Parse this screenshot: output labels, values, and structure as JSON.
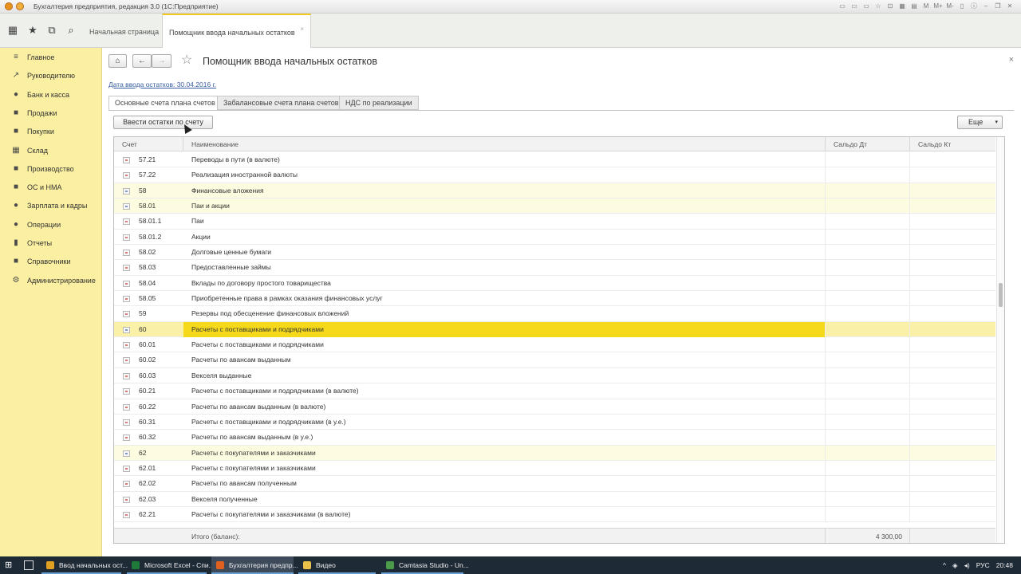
{
  "window": {
    "title": "Бухгалтерия предприятия, редакция 3.0  (1С:Предприятие)",
    "toolbar_icons": [
      "М",
      "М+",
      "М-"
    ]
  },
  "nav": {
    "tabs": [
      "Начальная страница",
      "Помощник ввода начальных остатков"
    ],
    "close": "×"
  },
  "sidebar": {
    "items": [
      {
        "label": "Главное",
        "icon": "menu-icon",
        "glyph": "≡"
      },
      {
        "label": "Руководителю",
        "icon": "chart-line-icon",
        "glyph": "↗"
      },
      {
        "label": "Банк и касса",
        "icon": "bank-icon",
        "glyph": "●"
      },
      {
        "label": "Продажи",
        "icon": "sales-icon",
        "glyph": "■"
      },
      {
        "label": "Покупки",
        "icon": "cart-icon",
        "glyph": "■"
      },
      {
        "label": "Склад",
        "icon": "warehouse-icon",
        "glyph": "▦"
      },
      {
        "label": "Производство",
        "icon": "factory-icon",
        "glyph": "■"
      },
      {
        "label": "ОС и НМА",
        "icon": "assets-icon",
        "glyph": "■"
      },
      {
        "label": "Зарплата и кадры",
        "icon": "person-icon",
        "glyph": "●"
      },
      {
        "label": "Операции",
        "icon": "operations-icon",
        "glyph": "●"
      },
      {
        "label": "Отчеты",
        "icon": "reports-icon",
        "glyph": "▮"
      },
      {
        "label": "Справочники",
        "icon": "books-icon",
        "glyph": "■"
      },
      {
        "label": "Администрирование",
        "icon": "gear-icon",
        "glyph": "⚙"
      }
    ]
  },
  "form": {
    "title": "Помощник ввода начальных остатков",
    "date_link": "Дата ввода остатков: 30.04.2016 г.",
    "tabs": [
      "Основные счета плана счетов",
      "Забалансовые счета плана счетов",
      "НДС по реализации"
    ],
    "enter_button": "Ввести остатки по счету",
    "more_button": "Еще",
    "close": "×"
  },
  "table": {
    "columns": [
      "Счет",
      "Наименование",
      "Сальдо Дт",
      "Сальдо Кт"
    ],
    "rows": [
      {
        "acc": "57.21",
        "name": "Переводы в пути (в валюте)",
        "group": false
      },
      {
        "acc": "57.22",
        "name": "Реализация иностранной валюты",
        "group": false
      },
      {
        "acc": "58",
        "name": "Финансовые вложения",
        "group": true
      },
      {
        "acc": "58.01",
        "name": "Паи и акции",
        "group": true
      },
      {
        "acc": "58.01.1",
        "name": "Паи",
        "group": false
      },
      {
        "acc": "58.01.2",
        "name": "Акции",
        "group": false
      },
      {
        "acc": "58.02",
        "name": "Долговые ценные бумаги",
        "group": false
      },
      {
        "acc": "58.03",
        "name": "Предоставленные займы",
        "group": false
      },
      {
        "acc": "58.04",
        "name": "Вклады по договору простого товарищества",
        "group": false
      },
      {
        "acc": "58.05",
        "name": "Приобретенные права в рамках оказания финансовых услуг",
        "group": false
      },
      {
        "acc": "59",
        "name": "Резервы под обесценение финансовых вложений",
        "group": false
      },
      {
        "acc": "60",
        "name": "Расчеты с поставщиками и подрядчиками",
        "group": true,
        "selected": true
      },
      {
        "acc": "60.01",
        "name": "Расчеты с поставщиками и подрядчиками",
        "group": false
      },
      {
        "acc": "60.02",
        "name": "Расчеты по авансам выданным",
        "group": false
      },
      {
        "acc": "60.03",
        "name": "Векселя выданные",
        "group": false
      },
      {
        "acc": "60.21",
        "name": "Расчеты с поставщиками и подрядчиками (в валюте)",
        "group": false
      },
      {
        "acc": "60.22",
        "name": "Расчеты по авансам выданным (в валюте)",
        "group": false
      },
      {
        "acc": "60.31",
        "name": "Расчеты с поставщиками и подрядчиками (в у.е.)",
        "group": false
      },
      {
        "acc": "60.32",
        "name": "Расчеты по авансам выданным (в у.е.)",
        "group": false
      },
      {
        "acc": "62",
        "name": "Расчеты с покупателями и заказчиками",
        "group": true
      },
      {
        "acc": "62.01",
        "name": "Расчеты с покупателями и заказчиками",
        "group": false
      },
      {
        "acc": "62.02",
        "name": "Расчеты по авансам полученным",
        "group": false
      },
      {
        "acc": "62.03",
        "name": "Векселя полученные",
        "group": false
      },
      {
        "acc": "62.21",
        "name": "Расчеты с покупателями и заказчиками (в валюте)",
        "group": false
      }
    ],
    "footer_label": "Итого (баланс):",
    "footer_dt": "4 300,00"
  },
  "taskbar": {
    "items": [
      {
        "label": "Ввод начальных ост...",
        "color": "#e0a020"
      },
      {
        "label": "Microsoft Excel - Спи...",
        "color": "#1f7a3a"
      },
      {
        "label": "Бухгалтерия предпр...",
        "color": "#e06020"
      },
      {
        "label": "Видео",
        "color": "#e8c04a"
      },
      {
        "label": "Camtasia Studio - Un...",
        "color": "#4a9a4a"
      }
    ],
    "lang": "РУС",
    "time": "20:48"
  }
}
